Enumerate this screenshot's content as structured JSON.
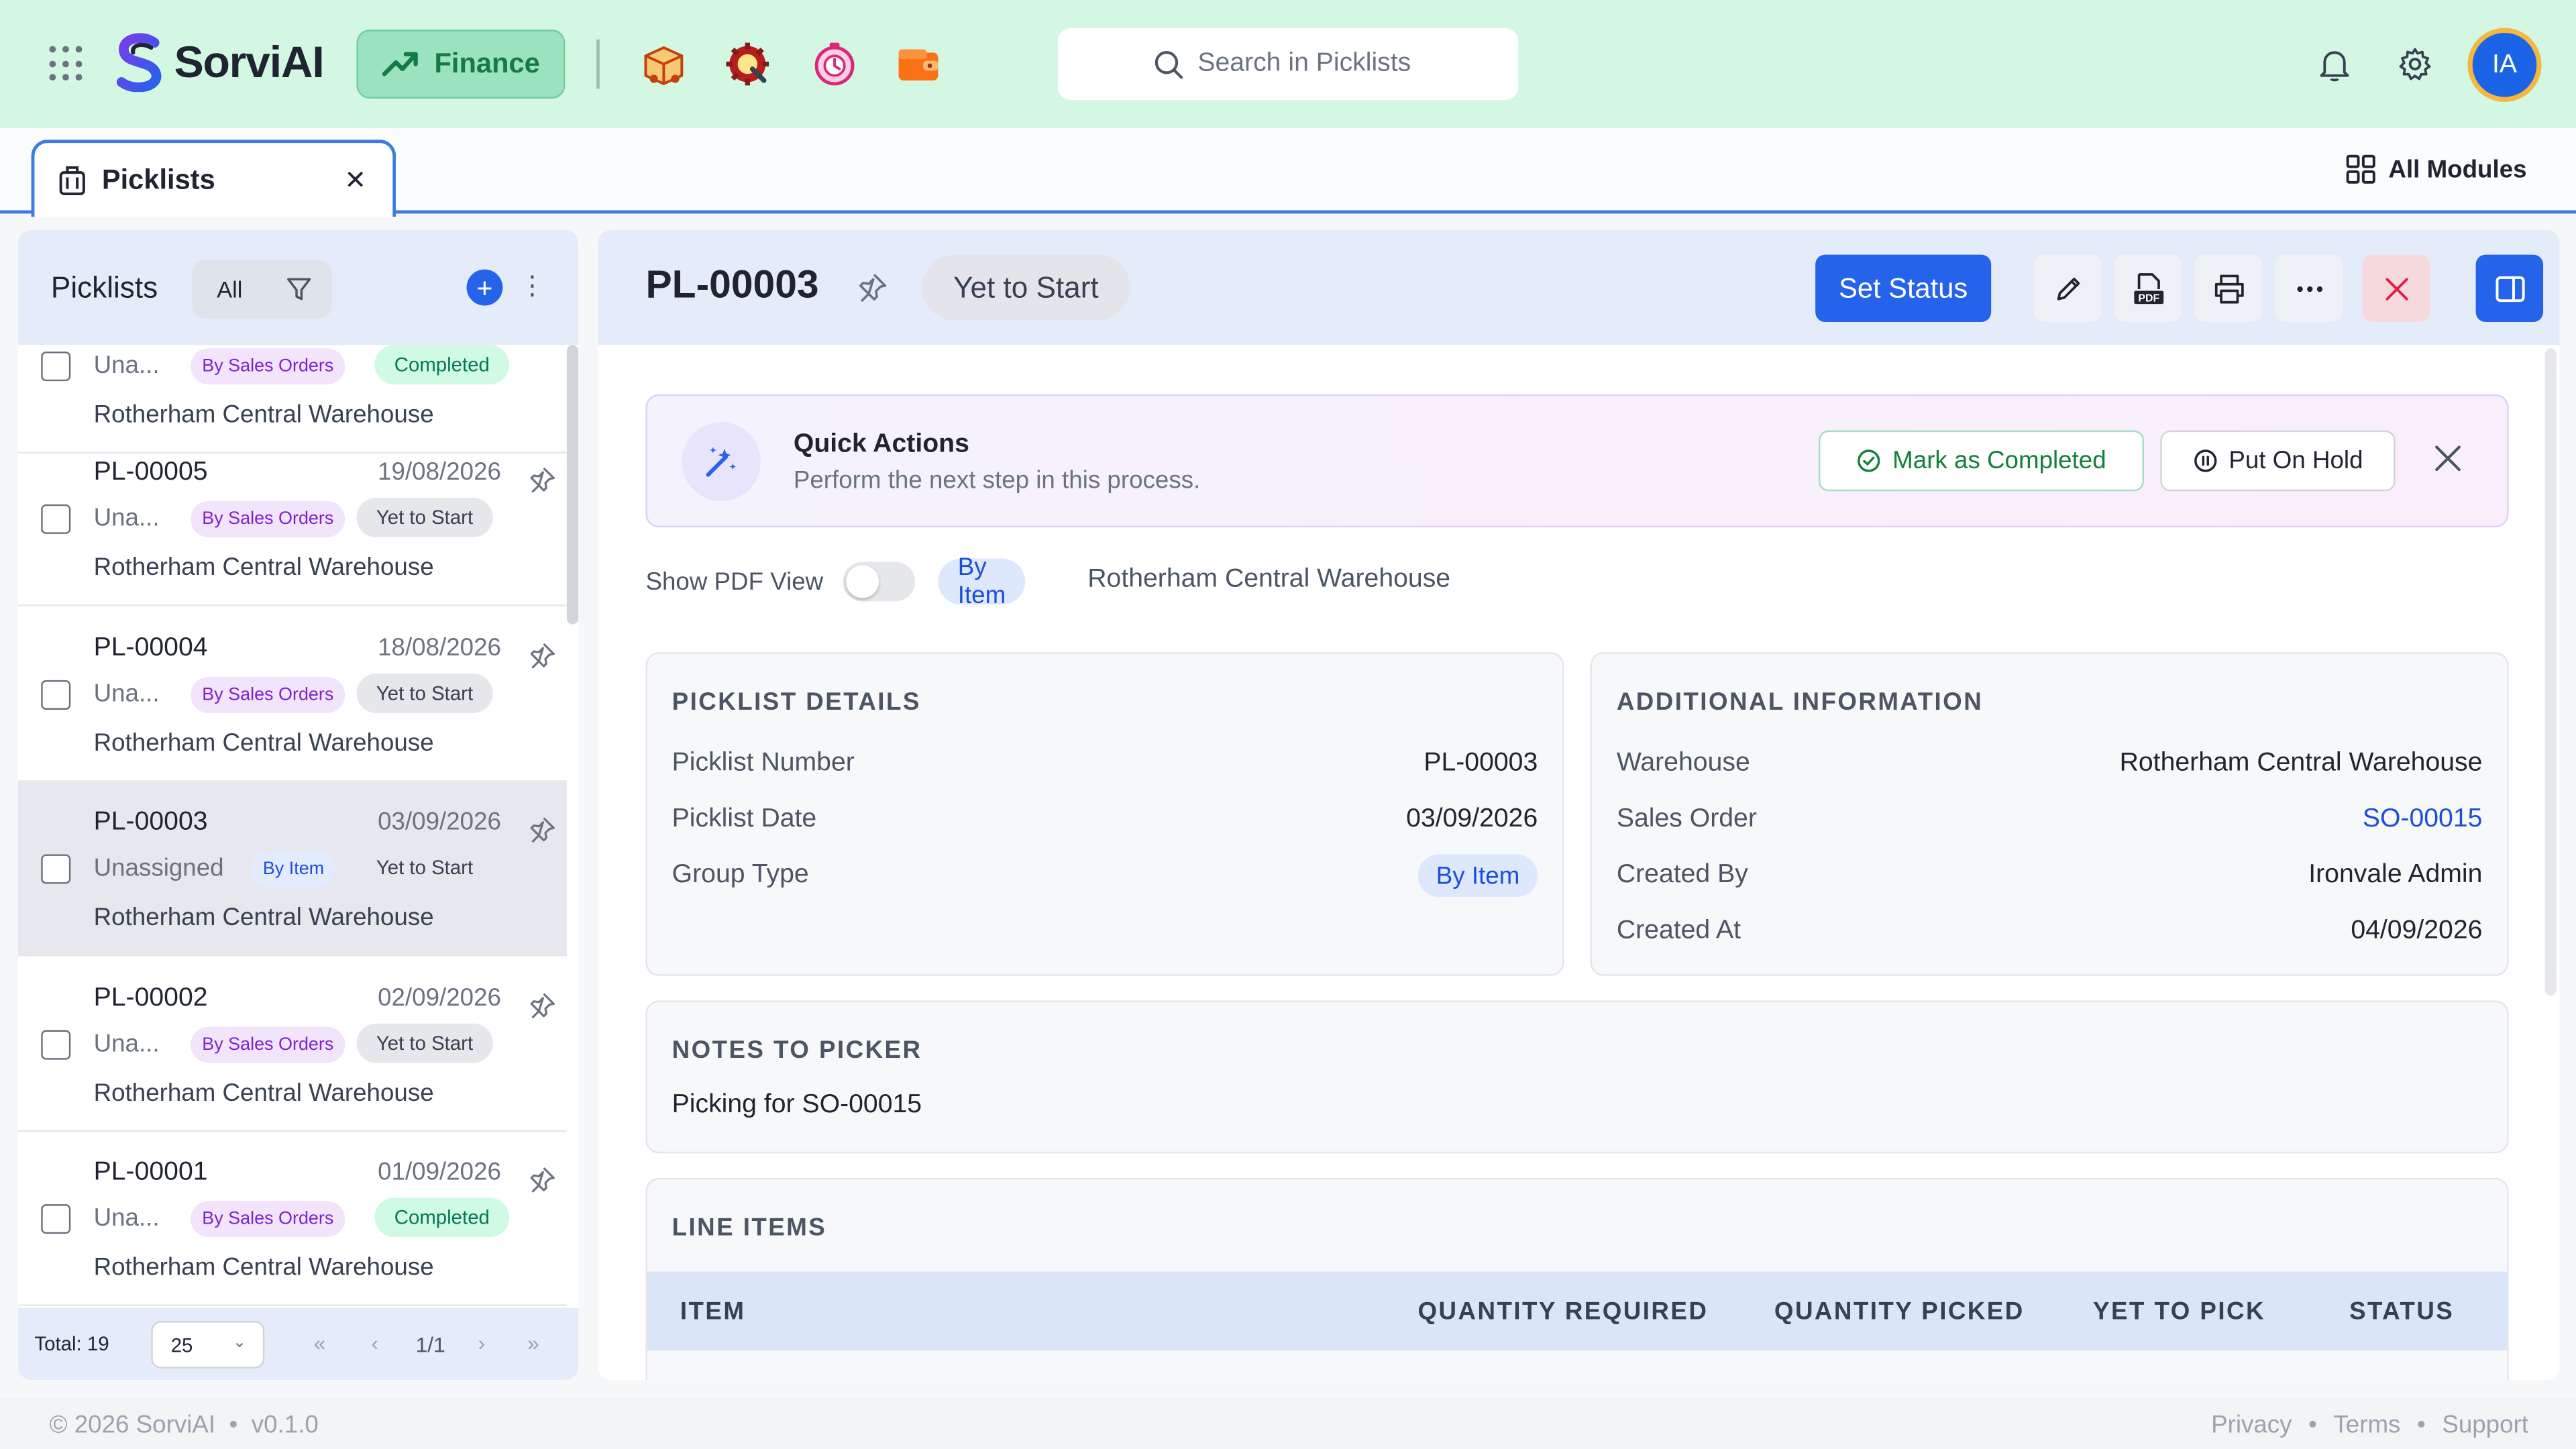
{
  "header": {
    "brand": "SorviAI",
    "module_label": "Finance",
    "search_placeholder": "Search in Picklists",
    "avatar_initials": "IA",
    "brand_colors": {
      "header_bg": "#d4f7e4",
      "accent": "#2563eb"
    }
  },
  "tabbar": {
    "active_tab": "Picklists",
    "all_modules": "All Modules"
  },
  "list_panel": {
    "title": "Picklists",
    "filter_value": "All",
    "items": [
      {
        "id": "",
        "date": "",
        "assignee": "Una...",
        "group": "By Sales Orders",
        "status": "Completed",
        "warehouse": "Rotherham Central Warehouse"
      },
      {
        "id": "PL-00005",
        "date": "19/08/2026",
        "assignee": "Una...",
        "group": "By Sales Orders",
        "status": "Yet to Start",
        "warehouse": "Rotherham Central Warehouse"
      },
      {
        "id": "PL-00004",
        "date": "18/08/2026",
        "assignee": "Una...",
        "group": "By Sales Orders",
        "status": "Yet to Start",
        "warehouse": "Rotherham Central Warehouse"
      },
      {
        "id": "PL-00003",
        "date": "03/09/2026",
        "assignee": "Unassigned",
        "group": "By Item",
        "status": "Yet to Start",
        "warehouse": "Rotherham Central Warehouse"
      },
      {
        "id": "PL-00002",
        "date": "02/09/2026",
        "assignee": "Una...",
        "group": "By Sales Orders",
        "status": "Yet to Start",
        "warehouse": "Rotherham Central Warehouse"
      },
      {
        "id": "PL-00001",
        "date": "01/09/2026",
        "assignee": "Una...",
        "group": "By Sales Orders",
        "status": "Completed",
        "warehouse": "Rotherham Central Warehouse"
      }
    ],
    "footer": {
      "total_label": "Total:",
      "total_value": "19",
      "page_size": "25",
      "page_indicator": "1/1"
    }
  },
  "detail": {
    "title": "PL-00003",
    "status": "Yet to Start",
    "set_status_label": "Set Status",
    "quick_actions": {
      "title": "Quick Actions",
      "subtitle": "Perform the next step in this process.",
      "complete_label": "Mark as Completed",
      "hold_label": "Put On Hold"
    },
    "options": {
      "pdf_label": "Show PDF View",
      "pdf_enabled": false,
      "group_chip": "By Item",
      "warehouse": "Rotherham Central Warehouse"
    },
    "picklist_details": {
      "heading": "PICKLIST DETAILS",
      "rows": [
        {
          "label": "Picklist Number",
          "value": "PL-00003"
        },
        {
          "label": "Picklist Date",
          "value": "03/09/2026"
        },
        {
          "label": "Group Type",
          "value": "By Item"
        }
      ]
    },
    "additional_info": {
      "heading": "ADDITIONAL INFORMATION",
      "rows": [
        {
          "label": "Warehouse",
          "value": "Rotherham Central Warehouse"
        },
        {
          "label": "Sales Order",
          "value": "SO-00015"
        },
        {
          "label": "Created By",
          "value": "Ironvale Admin"
        },
        {
          "label": "Created At",
          "value": "04/09/2026"
        }
      ]
    },
    "notes": {
      "heading": "NOTES TO PICKER",
      "text": "Picking for SO-00015"
    },
    "line_items": {
      "heading": "LINE ITEMS",
      "columns": [
        "ITEM",
        "QUANTITY REQUIRED",
        "QUANTITY PICKED",
        "YET TO PICK",
        "STATUS"
      ]
    }
  },
  "footer": {
    "copyright": "© 2026 SorviAI",
    "version": "v0.1.0",
    "links": [
      "Privacy",
      "Terms",
      "Support"
    ]
  }
}
